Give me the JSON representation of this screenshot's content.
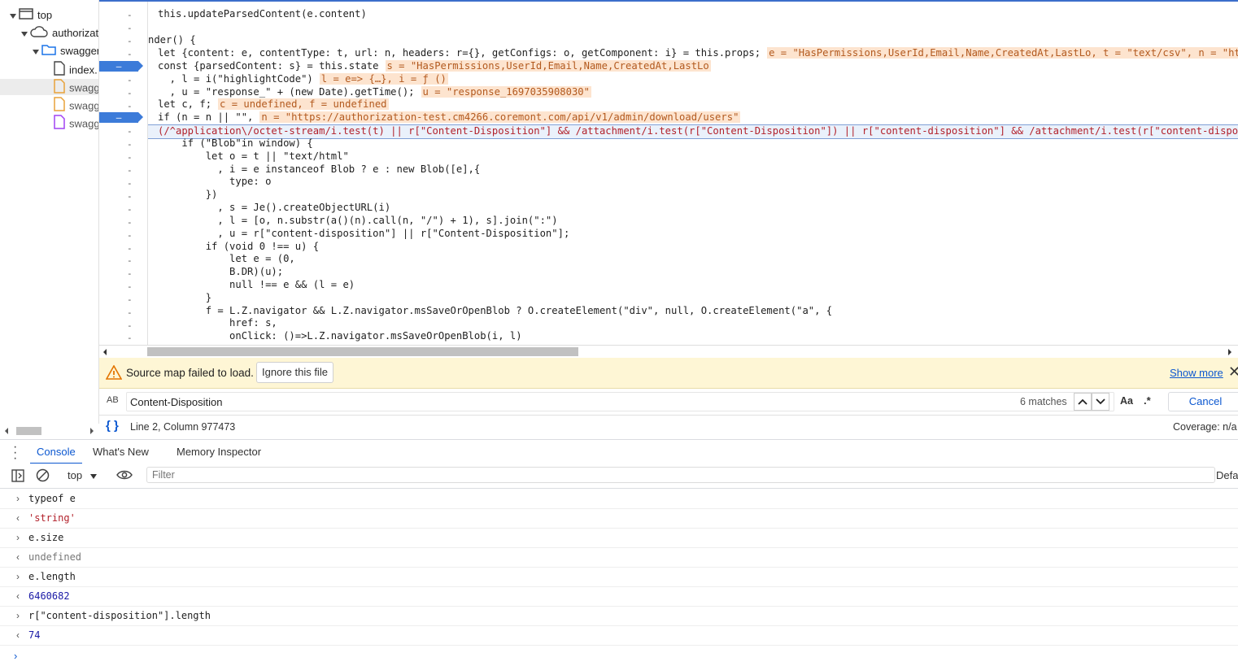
{
  "tree": {
    "items": [
      {
        "label": "top"
      },
      {
        "label": "authorizat"
      },
      {
        "label": "swagger"
      },
      {
        "label": "index."
      },
      {
        "label": "swagg"
      },
      {
        "label": "swagg"
      },
      {
        "label": "swagg"
      }
    ]
  },
  "editor": {
    "lines": [
      "this.updateParsedContent(e.content)",
      "",
      "nder() {",
      "let {content: e, contentType: t, url: n, headers: r={}, getConfigs: o, getComponent: i} = this.props;",
      "const {parsedContent: s} = this.state",
      "  , l = i(\"highlightCode\")",
      "  , u = \"response_\" + (new Date).getTime();",
      "let c, f;",
      "if (n = n || \"\",",
      "(/^application\\/octet-stream/i.test(t) || r[\"Content-Disposition\"] && /attachment/i.test(r[\"Content-Disposition\"]) || r[\"content-disposition\"] && /attachment/i.test(r[\"content-disposi",
      "    if (\"Blob\"in window) {",
      "        let o = t || \"text/html\"",
      "          , i = e instanceof Blob ? e : new Blob([e],{",
      "            type: o",
      "        })",
      "          , s = Je().createObjectURL(i)",
      "          , l = [o, n.substr(a()(n).call(n, \"/\") + 1), s].join(\":\")",
      "          , u = r[\"content-disposition\"] || r[\"Content-Disposition\"];",
      "        if (void 0 !== u) {",
      "            let e = (0,",
      "            B.DR)(u);",
      "            null !== e && (l = e)",
      "        }",
      "        f = L.Z.navigator && L.Z.navigator.msSaveOrOpenBlob ? O.createElement(\"div\", null, O.createElement(\"a\", {",
      "            href: s,",
      "            onClick: ()=>L.Z.navigator.msSaveOrOpenBlob(i, l)"
    ],
    "inline_values": {
      "props": "e = \"HasPermissions,UserId,Email,Name,CreatedAt,LastLo, t = \"text/csv\", n = \"ht",
      "state": "s = \"HasPermissions,UserId,Email,Name,CreatedAt,LastLo",
      "highlight": "l = e=> {…}, i = ƒ ()",
      "response": "u = \"response_1697035908030\"",
      "cf": "c = undefined, f = undefined",
      "url": "n = \"https://authorization-test.cm4266.coremont.com/api/v1/admin/download/users\""
    },
    "gutter_marker": "-",
    "breakpoint_marker": "–"
  },
  "warning": {
    "text": "Source map failed to load.",
    "ignore_label": "Ignore this file",
    "show_more": "Show more",
    "close": "✕"
  },
  "search": {
    "case_icon": "AB",
    "value": "Content-Disposition",
    "matches": "6 matches",
    "match_case": "Aa",
    "regex": ".*",
    "cancel": "Cancel"
  },
  "status": {
    "pretty_print": "{ }",
    "position": "Line 2, Column 977473",
    "coverage": "Coverage: n/a"
  },
  "drawer": {
    "tabs": [
      {
        "label": "Console"
      },
      {
        "label": "What's New"
      },
      {
        "label": "Memory Inspector"
      }
    ],
    "context": "top",
    "filter_placeholder": "Filter",
    "default_levels": "Defa"
  },
  "console": {
    "entries": [
      {
        "prompt": "›",
        "text": "typeof e",
        "type": "input"
      },
      {
        "prompt": "‹",
        "text": "'string'",
        "type": "string"
      },
      {
        "prompt": "›",
        "text": "e.size",
        "type": "input"
      },
      {
        "prompt": "‹",
        "text": "undefined",
        "type": "undefined"
      },
      {
        "prompt": "›",
        "text": "e.length",
        "type": "input"
      },
      {
        "prompt": "‹",
        "text": "6460682",
        "type": "number"
      },
      {
        "prompt": "›",
        "text": "r[\"content-disposition\"].length",
        "type": "input"
      },
      {
        "prompt": "‹",
        "text": "74",
        "type": "number"
      }
    ],
    "caret": "›"
  },
  "colors": {
    "accent": "#0b57d0",
    "breakpoint": "#3c7bd9",
    "inline_value_bg": "#fde4cf",
    "warning_bg": "#fef6d5",
    "string": "#b2212b",
    "keyword": "#9a2bc1"
  }
}
